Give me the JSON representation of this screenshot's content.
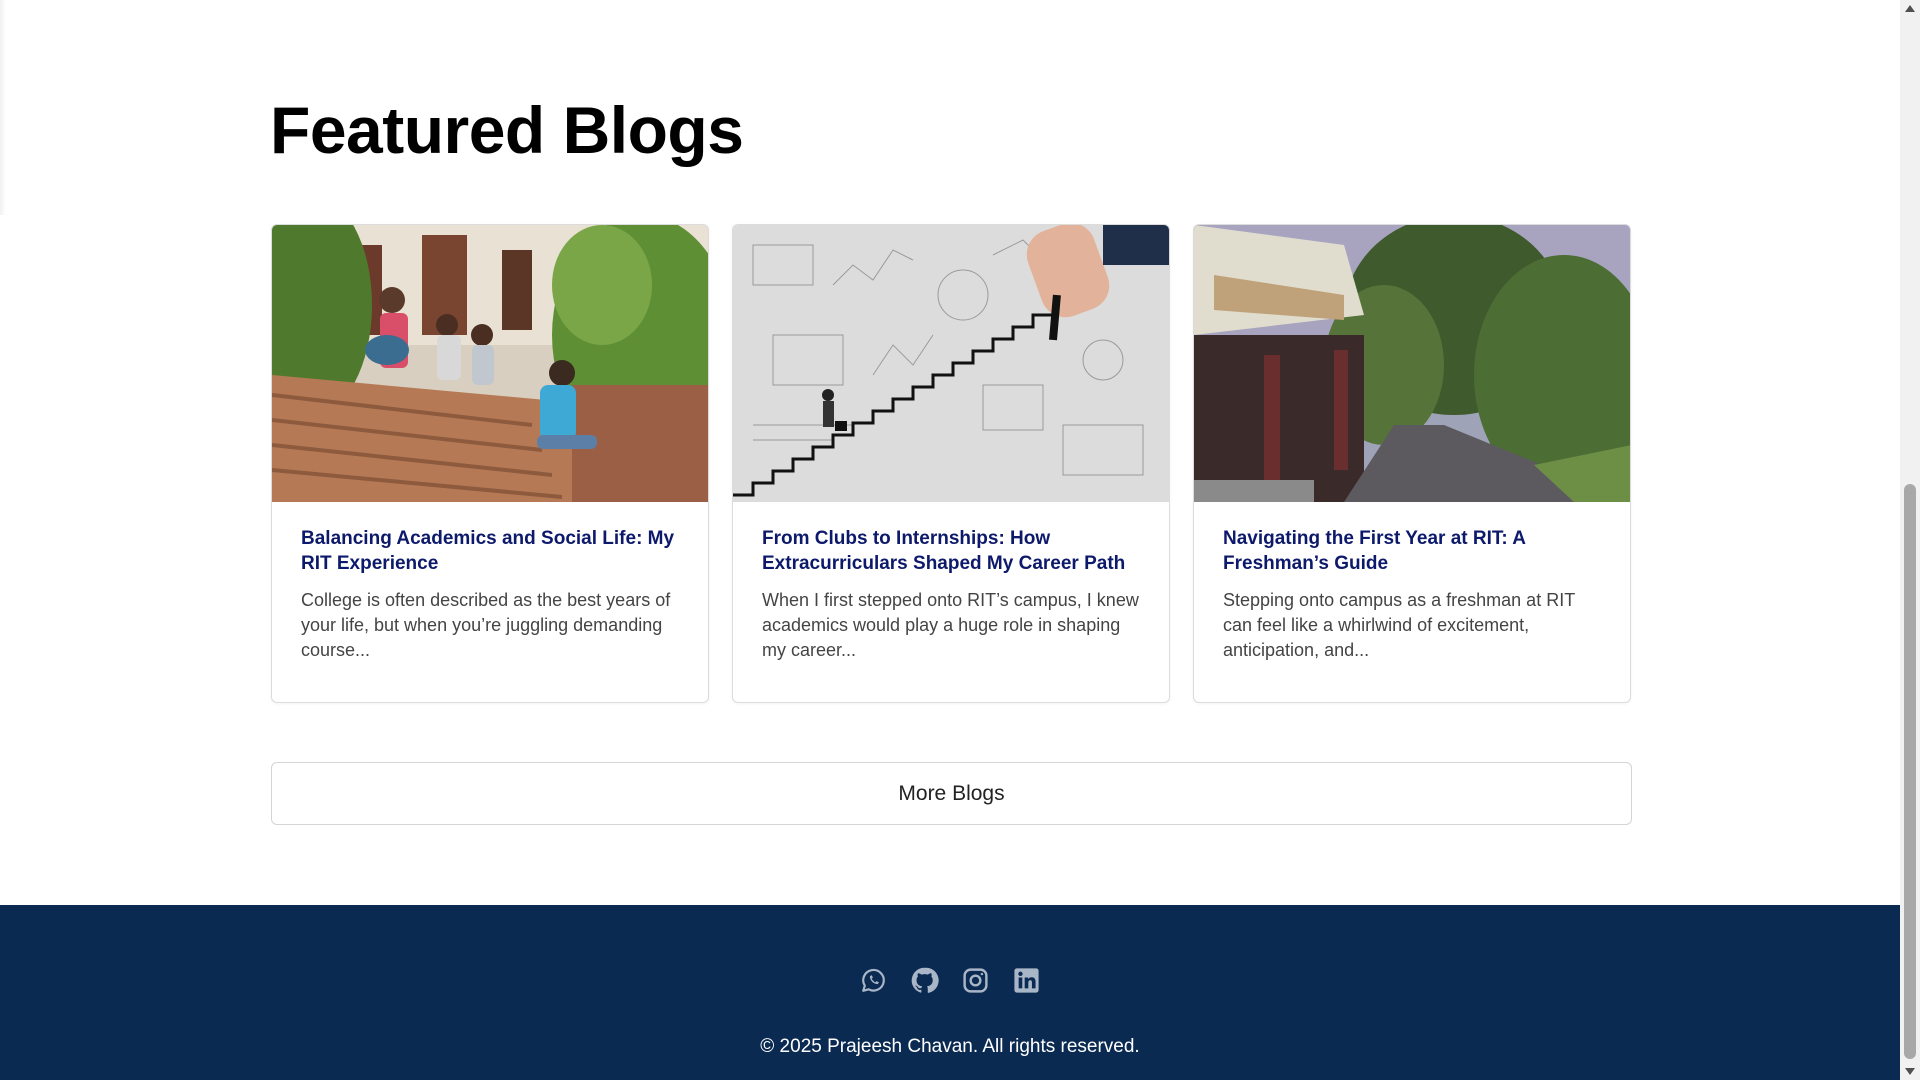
{
  "section": {
    "title": "Featured Blogs"
  },
  "blogs": [
    {
      "title": "Balancing Academics and Social Life: My RIT Experience",
      "excerpt": "College is often described as the best years of your life, but when you’re juggling demanding course..."
    },
    {
      "title": "From Clubs to Internships: How Extracurriculars Shaped My Career Path",
      "excerpt": "When I first stepped onto RIT’s campus, I knew academics would play a huge role in shaping my career..."
    },
    {
      "title": "Navigating the First Year at RIT: A Freshman’s Guide",
      "excerpt": "Stepping onto campus as a freshman at RIT can feel like a whirlwind of excitement, anticipation, and..."
    }
  ],
  "more_button": {
    "label": "More Blogs"
  },
  "footer": {
    "social_icons": [
      "whatsapp-icon",
      "github-icon",
      "instagram-icon",
      "linkedin-icon"
    ],
    "copyright": "© 2025 Prajeesh Chavan. All rights reserved."
  },
  "colors": {
    "footer_bg": "#0b2a52",
    "card_title": "#0d1a6b",
    "icon": "#a9b6c8"
  }
}
